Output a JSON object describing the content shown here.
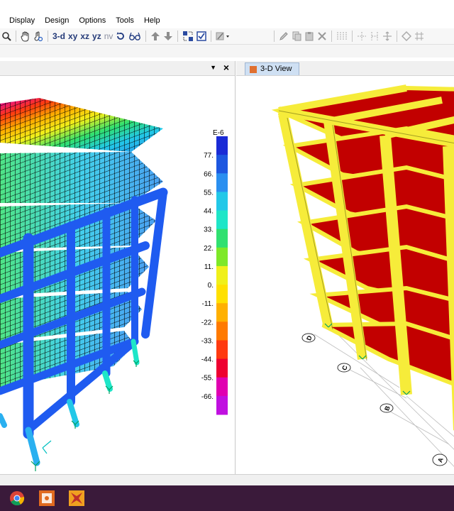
{
  "menu": [
    "Display",
    "Design",
    "Options",
    "Tools",
    "Help"
  ],
  "toolbar": {
    "view_3d": "3-d",
    "view_xy": "xy",
    "view_xz": "xz",
    "view_yz": "yz",
    "view_nv": "nv"
  },
  "right_pane": {
    "tab_label": "3-D View"
  },
  "legend": {
    "exponent": "E-6",
    "ticks": [
      "77.",
      "66.",
      "55.",
      "44.",
      "33.",
      "22.",
      "11.",
      "0.",
      "-11.",
      "-22.",
      "-33.",
      "-44.",
      "-55.",
      "-66."
    ],
    "colors": [
      "#1a2bd6",
      "#1d57e0",
      "#2a8ff0",
      "#22c8e8",
      "#1ee6c8",
      "#30e070",
      "#7ee828",
      "#f0f01a",
      "#ffe000",
      "#ffb000",
      "#ff7a00",
      "#ff3a10",
      "#ee0030",
      "#e000b0",
      "#c010e0"
    ]
  },
  "grid_labels": [
    "D",
    "C",
    "B",
    "A"
  ],
  "colors": {
    "frame_blue": "#1f5bf0",
    "frame_yellow": "#f6ec3a",
    "slab_red": "#c20000",
    "taskbar": "#3a1a3a"
  }
}
